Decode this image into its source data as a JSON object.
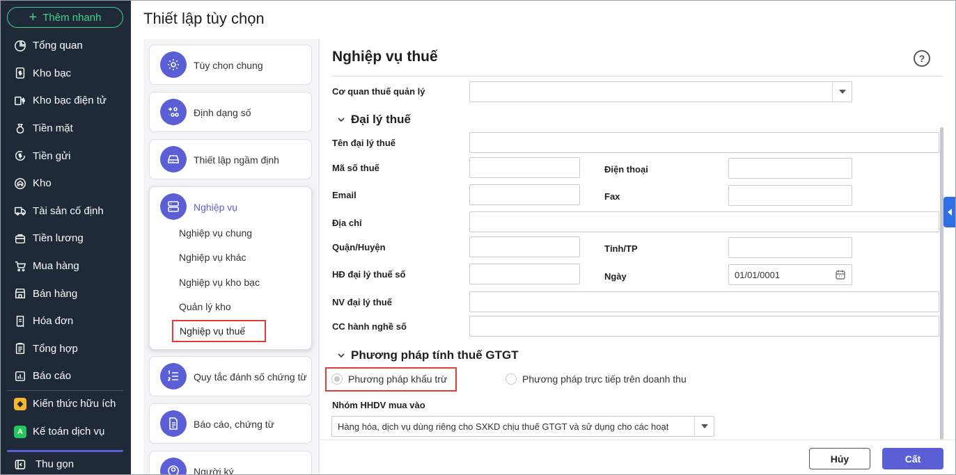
{
  "sidebar": {
    "quick_add": "Thêm nhanh",
    "items": [
      {
        "label": "Tổng quan",
        "icon": "pie-chart-icon"
      },
      {
        "label": "Kho bạc",
        "icon": "dollar-doc-icon"
      },
      {
        "label": "Kho bạc điện tử",
        "icon": "cards-dollar-icon"
      },
      {
        "label": "Tiền mặt",
        "icon": "cash-bag-icon"
      },
      {
        "label": "Tiền gửi",
        "icon": "deposit-icon"
      },
      {
        "label": "Kho",
        "icon": "warehouse-icon"
      },
      {
        "label": "Tài sản cố định",
        "icon": "truck-icon"
      },
      {
        "label": "Tiền lương",
        "icon": "salary-icon"
      },
      {
        "label": "Mua hàng",
        "icon": "cart-icon"
      },
      {
        "label": "Bán hàng",
        "icon": "store-icon"
      },
      {
        "label": "Hóa đơn",
        "icon": "invoice-icon"
      },
      {
        "label": "Tổng hợp",
        "icon": "summary-icon"
      },
      {
        "label": "Báo cáo",
        "icon": "report-icon"
      }
    ],
    "extras": [
      {
        "label": "Kiến thức hữu ích",
        "icon": "knowledge-icon",
        "color": "#f5b731"
      },
      {
        "label": "Kế toán dịch vụ",
        "icon": "accounting-service-icon",
        "color": "#22c55e"
      }
    ],
    "collapse": "Thu gọn"
  },
  "page_title": "Thiết lập tùy chọn",
  "settings_menu": {
    "cards": [
      {
        "label": "Tùy chọn chung",
        "icon": "gear-icon"
      },
      {
        "label": "Định dạng số",
        "icon": "number-format-icon"
      },
      {
        "label": "Thiết lập ngầm định",
        "icon": "drive-icon"
      },
      {
        "label": "Nghiệp vụ",
        "icon": "server-icon"
      },
      {
        "label": "Quy tắc đánh số chứng từ",
        "icon": "numbered-list-icon"
      },
      {
        "label": "Báo cáo, chứng từ",
        "icon": "document-icon"
      },
      {
        "label": "Người ký",
        "icon": "signer-icon"
      }
    ],
    "sub_items": [
      "Nghiệp vụ chung",
      "Nghiệp vụ khác",
      "Nghiệp vụ kho bạc",
      "Quản lý kho",
      "Nghiệp vụ thuế"
    ],
    "active_sub": "Nghiệp vụ thuế"
  },
  "form": {
    "title": "Nghiệp vụ thuế",
    "help": "?",
    "tax_office_label": "Cơ quan thuế quản lý",
    "tax_office_value": "",
    "section_agent": "Đại lý thuế",
    "agent_name_label": "Tên đại lý thuế",
    "tax_code_label": "Mã số thuế",
    "phone_label": "Điện thoại",
    "email_label": "Email",
    "fax_label": "Fax",
    "address_label": "Địa chỉ",
    "district_label": "Quận/Huyện",
    "province_label": "Tỉnh/TP",
    "contract_label": "HĐ đại lý thuế số",
    "date_label": "Ngày",
    "date_value": "01/01/0001",
    "staff_label": "NV đại lý thuế",
    "cert_label": "CC hành nghề số",
    "section_vat": "Phương pháp tính thuế GTGT",
    "radio_deduction": "Phương pháp khấu trừ",
    "radio_direct": "Phương pháp trực tiếp trên doanh thu",
    "group_label": "Nhóm HHDV mua vào",
    "group_value": "Hàng hóa, dịch vụ dùng riêng cho SXKD chịu thuế GTGT và sử dụng cho các hoạt"
  },
  "footer": {
    "cancel": "Hủy",
    "save": "Cất"
  }
}
